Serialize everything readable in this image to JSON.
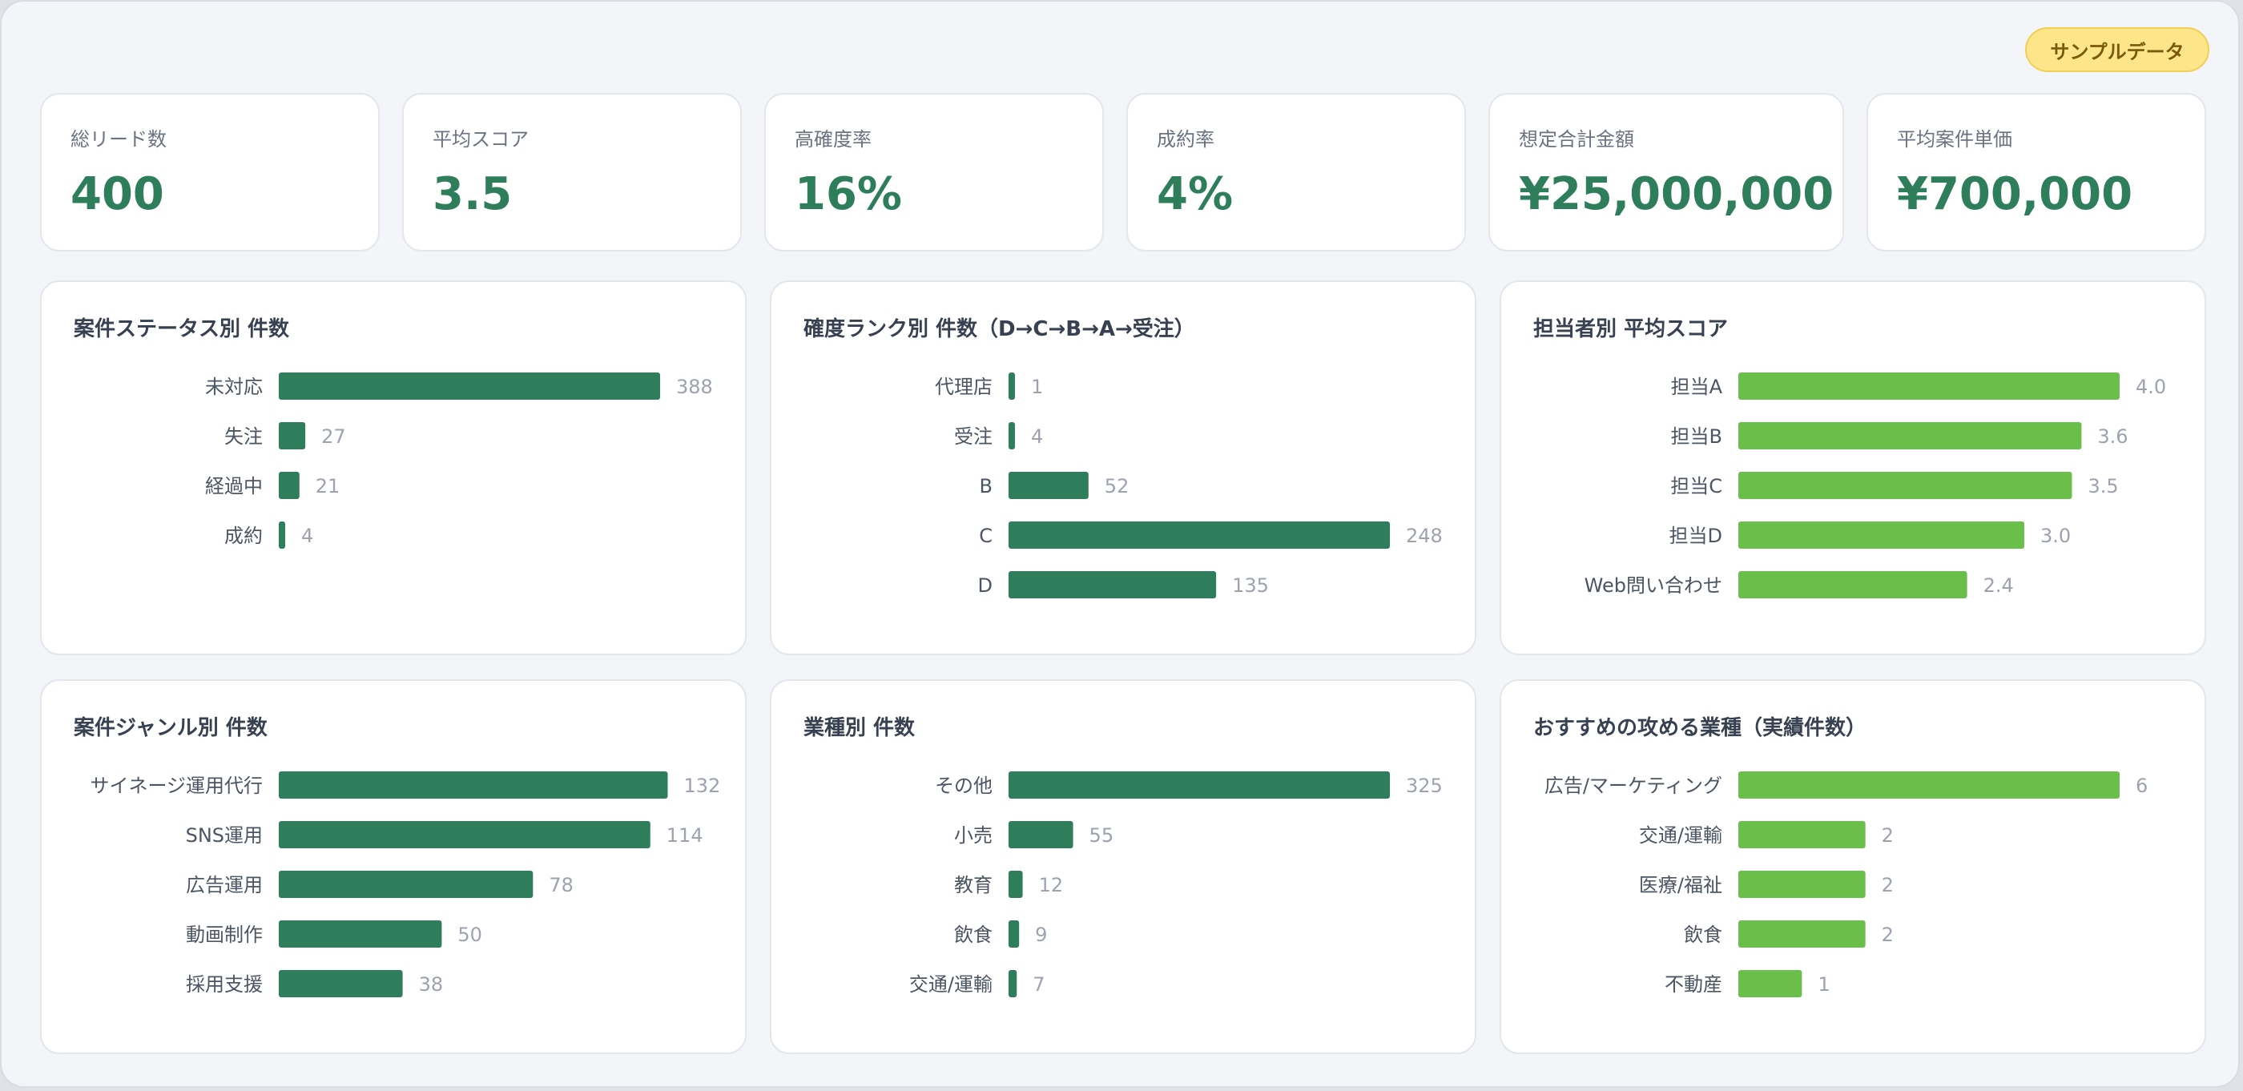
{
  "badge": "サンプルデータ",
  "kpis": [
    {
      "label": "総リード数",
      "value": "400"
    },
    {
      "label": "平均スコア",
      "value": "3.5"
    },
    {
      "label": "高確度率",
      "value": "16%"
    },
    {
      "label": "成約率",
      "value": "4%"
    },
    {
      "label": "想定合計金額",
      "value": "¥25,000,000"
    },
    {
      "label": "平均案件単価",
      "value": "¥700,000"
    }
  ],
  "colors": {
    "dark_green": "#2e7d5b",
    "light_green": "#6abf4b"
  },
  "chart_data": [
    {
      "type": "bar",
      "orientation": "horizontal",
      "title": "案件ステータス別 件数",
      "categories": [
        "未対応",
        "失注",
        "経過中",
        "成約"
      ],
      "values": [
        388,
        27,
        21,
        4
      ],
      "value_labels": [
        "388",
        "27",
        "21",
        "4"
      ],
      "xlim": [
        0,
        388
      ],
      "color": "#2e7d5b"
    },
    {
      "type": "bar",
      "orientation": "horizontal",
      "title": "確度ランク別 件数（D→C→B→A→受注）",
      "categories": [
        "代理店",
        "受注",
        "B",
        "C",
        "D"
      ],
      "values": [
        1,
        4,
        52,
        248,
        135
      ],
      "value_labels": [
        "1",
        "4",
        "52",
        "248",
        "135"
      ],
      "xlim": [
        0,
        248
      ],
      "color": "#2e7d5b"
    },
    {
      "type": "bar",
      "orientation": "horizontal",
      "title": "担当者別 平均スコア",
      "categories": [
        "担当A",
        "担当B",
        "担当C",
        "担当D",
        "Web問い合わせ"
      ],
      "values": [
        4.0,
        3.6,
        3.5,
        3.0,
        2.4
      ],
      "value_labels": [
        "4.0",
        "3.6",
        "3.5",
        "3.0",
        "2.4"
      ],
      "xlim": [
        0,
        4.0
      ],
      "color": "#6abf4b"
    },
    {
      "type": "bar",
      "orientation": "horizontal",
      "title": "案件ジャンル別 件数",
      "categories": [
        "サイネージ運用代行",
        "SNS運用",
        "広告運用",
        "動画制作",
        "採用支援"
      ],
      "values": [
        132,
        114,
        78,
        50,
        38
      ],
      "value_labels": [
        "132",
        "114",
        "78",
        "50",
        "38"
      ],
      "xlim": [
        0,
        117
      ],
      "color": "#2e7d5b"
    },
    {
      "type": "bar",
      "orientation": "horizontal",
      "title": "業種別 件数",
      "categories": [
        "その他",
        "小売",
        "教育",
        "飲食",
        "交通/運輸"
      ],
      "values": [
        325,
        55,
        12,
        9,
        7
      ],
      "value_labels": [
        "325",
        "55",
        "12",
        "9",
        "7"
      ],
      "xlim": [
        0,
        325
      ],
      "color": "#2e7d5b"
    },
    {
      "type": "bar",
      "orientation": "horizontal",
      "title": "おすすめの攻める業種（実績件数）",
      "categories": [
        "広告/マーケティング",
        "交通/運輸",
        "医療/福祉",
        "飲食",
        "不動産"
      ],
      "values": [
        6,
        2,
        2,
        2,
        1
      ],
      "value_labels": [
        "6",
        "2",
        "2",
        "2",
        "1"
      ],
      "xlim": [
        0,
        6
      ],
      "color": "#6abf4b"
    }
  ]
}
